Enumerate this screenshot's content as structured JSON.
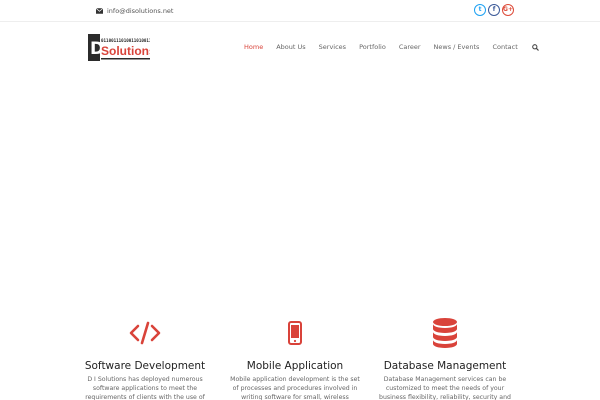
{
  "topbar": {
    "email": "info@disolutions.net",
    "social": [
      {
        "icon": "twitter-icon",
        "glyph": "t"
      },
      {
        "icon": "facebook-icon",
        "glyph": "f"
      },
      {
        "icon": "google-plus-icon",
        "glyph": "G+"
      }
    ]
  },
  "logo": {
    "mark": "D",
    "dots": "0110011101001101001100",
    "name": "Solutions"
  },
  "nav": {
    "items": [
      "Home",
      "About Us",
      "Services",
      "Portfolio",
      "Career",
      "News / Events",
      "Contact"
    ],
    "active": "Home",
    "search_icon": "search-icon"
  },
  "colors": {
    "accent": "#d9433a",
    "logo_dark": "#2b2b2b"
  },
  "features": [
    {
      "icon": "code-icon",
      "title": "Software Development",
      "text": "D I Solutions has deployed numerous software applications to meet the requirements of clients with the use of modern software"
    },
    {
      "icon": "mobile-phone-icon",
      "title": "Mobile Application",
      "text": "Mobile application development is the set of processes and procedures involved in writing software for small, wireless computing devices"
    },
    {
      "icon": "database-icon",
      "title": "Database Management",
      "text": "Database Management services can be customized to meet the needs of your business flexibility, reliability, security and"
    }
  ]
}
